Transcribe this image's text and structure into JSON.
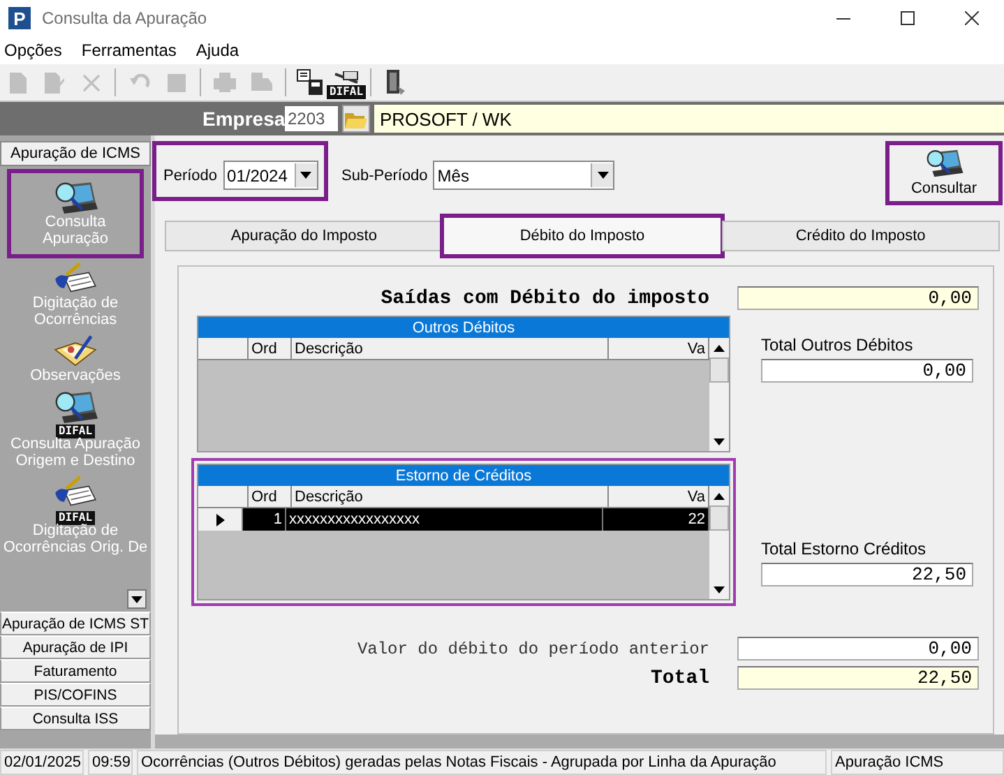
{
  "window": {
    "logo": "P",
    "title": "Consulta da Apuração"
  },
  "menu": [
    "Opções",
    "Ferramentas",
    "Ajuda"
  ],
  "toolbar": [
    {
      "kind": "new",
      "disabled": true
    },
    {
      "kind": "edit",
      "disabled": true
    },
    {
      "kind": "delete",
      "disabled": true
    },
    {
      "kind": "separator"
    },
    {
      "kind": "undo",
      "disabled": true
    },
    {
      "kind": "stop",
      "disabled": true
    },
    {
      "kind": "separator"
    },
    {
      "kind": "print",
      "disabled": true
    },
    {
      "kind": "truck",
      "disabled": true
    },
    {
      "kind": "separator"
    },
    {
      "kind": "export",
      "disabled": false
    },
    {
      "kind": "difal",
      "disabled": false,
      "badge": "DIFAL"
    },
    {
      "kind": "separator"
    },
    {
      "kind": "exit",
      "disabled": false
    }
  ],
  "company": {
    "label": "Empresa",
    "code": "2203",
    "name": "PROSOFT / WK"
  },
  "sidebar": {
    "group": "Apuração de ICMS",
    "items": [
      {
        "label": "Consulta Apuração",
        "kind": "consulta",
        "highlighted": true
      },
      {
        "label": "Digitação de Ocorrências",
        "kind": "digitacao",
        "highlighted": false
      },
      {
        "label": "Observações",
        "kind": "observacoes",
        "highlighted": false
      },
      {
        "label": "Consulta Apuração Origem e Destino",
        "kind": "consulta",
        "badge": "DIFAL",
        "highlighted": false
      },
      {
        "label": "Digitação de Ocorrências Orig. De",
        "kind": "digitacao",
        "badge": "DIFAL",
        "highlighted": false
      }
    ],
    "sections": [
      "Apuração de ICMS ST",
      "Apuração de IPI",
      "Faturamento",
      "PIS/COFINS",
      "Consulta ISS"
    ]
  },
  "filters": {
    "period": {
      "label": "Período",
      "value": "01/2024",
      "highlighted": true
    },
    "sub_period": {
      "label": "Sub-Período",
      "value": "Mês",
      "highlighted": false
    }
  },
  "consult_button": {
    "label": "Consultar",
    "highlighted": true
  },
  "tabs": [
    {
      "label": "Apuração do Imposto",
      "selected": false,
      "highlighted": false
    },
    {
      "label": "Débito do Imposto",
      "selected": true,
      "highlighted": true
    },
    {
      "label": "Crédito do Imposto",
      "selected": false,
      "highlighted": false
    }
  ],
  "saidas": {
    "label": "Saídas com Débito do imposto",
    "value": "0,00"
  },
  "grids": [
    {
      "title": "Outros Débitos",
      "columns": [
        "Ord",
        "Descrição",
        "Va"
      ],
      "total_label": "Total Outros Débitos",
      "total": "0,00",
      "highlighted": false
    },
    {
      "title": "Estorno de Créditos",
      "columns": [
        "Ord",
        "Descrição",
        "Va"
      ],
      "rows": [
        {
          "cells": [
            "1",
            "xxxxxxxxxxxxxxxxx",
            "22"
          ],
          "selected": true
        }
      ],
      "total_label": "Total Estorno Créditos",
      "total": "22,50",
      "highlighted": true
    }
  ],
  "previous": {
    "label": "Valor do débito do período anterior",
    "value": "0,00"
  },
  "total": {
    "label": "Total",
    "value": "22,50"
  },
  "status_bar": [
    "02/01/2025",
    "09:59",
    "Ocorrências (Outros Débitos) geradas pelas Notas Fiscais - Agrupada por Linha da Apuração",
    "Apuração ICMS"
  ]
}
